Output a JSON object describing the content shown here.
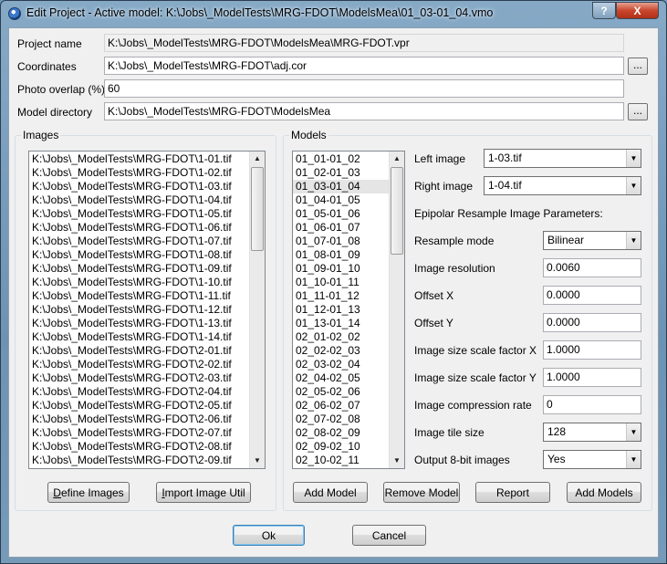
{
  "window": {
    "title": "Edit Project - Active model: K:\\Jobs\\_ModelTests\\MRG-FDOT\\ModelsMea\\01_03-01_04.vmo",
    "help_label": "?",
    "close_label": "X"
  },
  "form": {
    "project_name_label": "Project name",
    "project_name_value": "K:\\Jobs\\_ModelTests\\MRG-FDOT\\ModelsMea\\MRG-FDOT.vpr",
    "coordinates_label": "Coordinates",
    "coordinates_value": "K:\\Jobs\\_ModelTests\\MRG-FDOT\\adj.cor",
    "photo_overlap_label": "Photo overlap (%)",
    "photo_overlap_value": "60",
    "model_directory_label": "Model directory",
    "model_directory_value": "K:\\Jobs\\_ModelTests\\MRG-FDOT\\ModelsMea",
    "browse_label": "..."
  },
  "images": {
    "group_title": "Images",
    "items": [
      "K:\\Jobs\\_ModelTests\\MRG-FDOT\\1-01.tif",
      "K:\\Jobs\\_ModelTests\\MRG-FDOT\\1-02.tif",
      "K:\\Jobs\\_ModelTests\\MRG-FDOT\\1-03.tif",
      "K:\\Jobs\\_ModelTests\\MRG-FDOT\\1-04.tif",
      "K:\\Jobs\\_ModelTests\\MRG-FDOT\\1-05.tif",
      "K:\\Jobs\\_ModelTests\\MRG-FDOT\\1-06.tif",
      "K:\\Jobs\\_ModelTests\\MRG-FDOT\\1-07.tif",
      "K:\\Jobs\\_ModelTests\\MRG-FDOT\\1-08.tif",
      "K:\\Jobs\\_ModelTests\\MRG-FDOT\\1-09.tif",
      "K:\\Jobs\\_ModelTests\\MRG-FDOT\\1-10.tif",
      "K:\\Jobs\\_ModelTests\\MRG-FDOT\\1-11.tif",
      "K:\\Jobs\\_ModelTests\\MRG-FDOT\\1-12.tif",
      "K:\\Jobs\\_ModelTests\\MRG-FDOT\\1-13.tif",
      "K:\\Jobs\\_ModelTests\\MRG-FDOT\\1-14.tif",
      "K:\\Jobs\\_ModelTests\\MRG-FDOT\\2-01.tif",
      "K:\\Jobs\\_ModelTests\\MRG-FDOT\\2-02.tif",
      "K:\\Jobs\\_ModelTests\\MRG-FDOT\\2-03.tif",
      "K:\\Jobs\\_ModelTests\\MRG-FDOT\\2-04.tif",
      "K:\\Jobs\\_ModelTests\\MRG-FDOT\\2-05.tif",
      "K:\\Jobs\\_ModelTests\\MRG-FDOT\\2-06.tif",
      "K:\\Jobs\\_ModelTests\\MRG-FDOT\\2-07.tif",
      "K:\\Jobs\\_ModelTests\\MRG-FDOT\\2-08.tif",
      "K:\\Jobs\\_ModelTests\\MRG-FDOT\\2-09.tif"
    ],
    "define_images_accel": "D",
    "define_images_rest": "efine Images",
    "import_accel": "I",
    "import_rest": "mport Image Util"
  },
  "models": {
    "group_title": "Models",
    "selected_index": 2,
    "items": [
      "01_01-01_02",
      "01_02-01_03",
      "01_03-01_04",
      "01_04-01_05",
      "01_05-01_06",
      "01_06-01_07",
      "01_07-01_08",
      "01_08-01_09",
      "01_09-01_10",
      "01_10-01_11",
      "01_11-01_12",
      "01_12-01_13",
      "01_13-01_14",
      "02_01-02_02",
      "02_02-02_03",
      "02_03-02_04",
      "02_04-02_05",
      "02_05-02_06",
      "02_06-02_07",
      "02_07-02_08",
      "02_08-02_09",
      "02_09-02_10",
      "02_10-02_11"
    ],
    "left_image_label": "Left image",
    "left_image_value": "1-03.tif",
    "right_image_label": "Right image",
    "right_image_value": "1-04.tif",
    "epipolar_heading": "Epipolar Resample Image Parameters:",
    "resample_mode_label": "Resample mode",
    "resample_mode_value": "Bilinear",
    "image_resolution_label": "Image resolution",
    "image_resolution_value": "0.0060",
    "offset_x_label": "Offset X",
    "offset_x_value": "0.0000",
    "offset_y_label": "Offset Y",
    "offset_y_value": "0.0000",
    "scale_x_label": "Image size scale factor X",
    "scale_x_value": "1.0000",
    "scale_y_label": "Image size scale factor Y",
    "scale_y_value": "1.0000",
    "compression_label": "Image compression rate",
    "compression_value": "0",
    "tile_size_label": "Image tile size",
    "tile_size_value": "128",
    "output_8bit_label": "Output 8-bit images",
    "output_8bit_value": "Yes",
    "add_model_label": "Add Model",
    "remove_model_label": "Remove Model",
    "report_label": "Report",
    "add_models_label": "Add Models"
  },
  "footer": {
    "ok_label": "Ok",
    "cancel_label": "Cancel"
  }
}
